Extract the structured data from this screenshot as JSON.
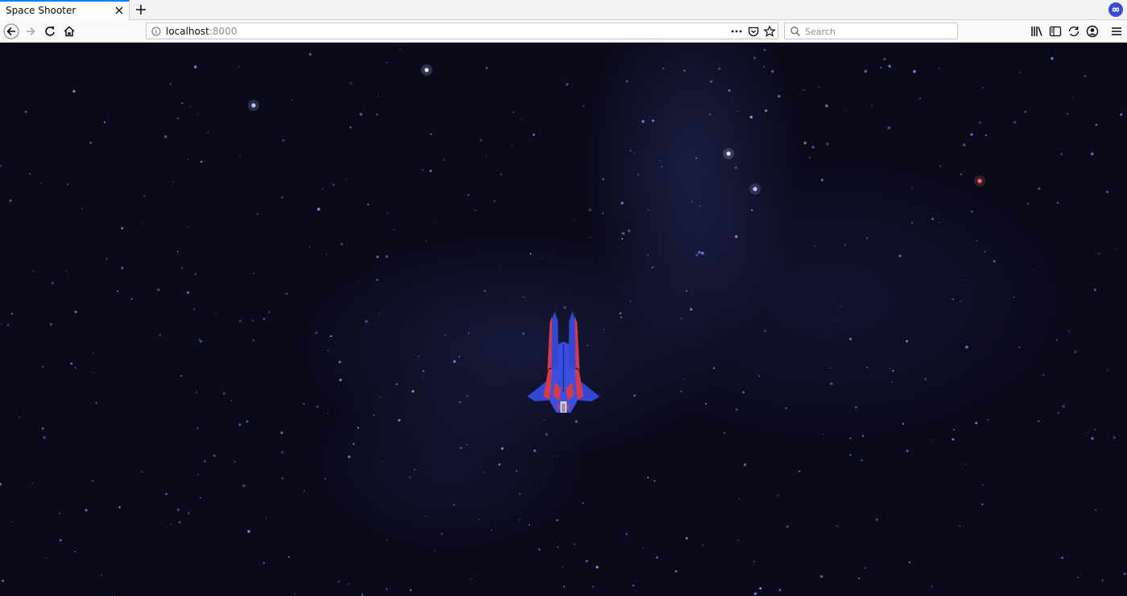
{
  "browser": {
    "tab_title": "Space Shooter",
    "url_host": "localhost",
    "url_port": ":8000",
    "search_placeholder": "Search"
  },
  "icons": {
    "tab_close": "close-icon",
    "new_tab": "plus-icon",
    "extension": "infinity-icon",
    "back": "arrow-left-icon",
    "forward": "arrow-right-icon",
    "reload": "reload-icon",
    "home": "home-icon",
    "site_info": "info-icon",
    "page_actions": "more-dots-icon",
    "pocket": "pocket-icon",
    "bookmark": "star-icon",
    "search": "search-icon",
    "library": "library-icon",
    "sidebar": "sidebar-icon",
    "sync": "sync-icon",
    "account": "account-icon",
    "menu": "hamburger-icon"
  },
  "colors": {
    "space_background": "#0b0a1b",
    "star": "#8f9dff",
    "ship_body": "#3346d4",
    "ship_stripe": "#d23a4e",
    "accent": "#0a84ff"
  }
}
